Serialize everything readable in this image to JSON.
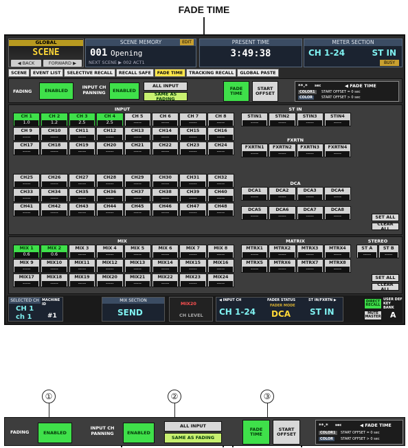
{
  "callout_title": "FADE TIME",
  "header": {
    "global": "GLOBAL",
    "scene": "SCENE",
    "back": "◀ BACK",
    "forward": "FORWARD ▶",
    "scene_memory_title": "SCENE MEMORY",
    "scene_number": "001",
    "scene_name": "Opening",
    "edit": "EDIT",
    "next": "NEXT SCENE",
    "next_scene": "▶ 002 ACT1",
    "present_time_title": "PRESENT TIME",
    "present_time": "3:49:38",
    "meter_title": "METER SECTION",
    "meter_ch": "CH 1-24",
    "meter_st": "ST IN",
    "busy": "BUSY"
  },
  "tabs": [
    "SCENE",
    "EVENT LIST",
    "SELECTIVE RECALL",
    "RECALL SAFE",
    "FADE TIME",
    "TRACKING RECALL",
    "GLOBAL PASTE"
  ],
  "active_tab": "FADE TIME",
  "controls": {
    "fading_label": "FADING",
    "fading_value": "ENABLED",
    "panning_label": "INPUT CH PANNING",
    "panning_value": "ENABLED",
    "all_input": "ALL INPUT",
    "same_as_fading": "SAME AS FADING",
    "fade_time": "FADE TIME",
    "start_offset": "START OFFSET",
    "legend_value": "**.*",
    "legend_sec": "sec",
    "legend_title": "◀ FADE TIME",
    "legend_color1": "COLOR1",
    "legend_color2": "COLOR",
    "legend_line1": "START OFFSET = 0 sec",
    "legend_line2": "START OFFSET > 0 sec"
  },
  "input": {
    "title": "INPUT",
    "channels": [
      {
        "name": "CH 1",
        "value": "1.0",
        "on": true
      },
      {
        "name": "CH 2",
        "value": "1.2",
        "on": true
      },
      {
        "name": "CH 3",
        "value": "2.5",
        "on": true
      },
      {
        "name": "CH 4",
        "value": "2.5",
        "on": true
      },
      {
        "name": "CH 5",
        "value": "-----",
        "on": false
      },
      {
        "name": "CH 6",
        "value": "-----",
        "on": false
      },
      {
        "name": "CH 7",
        "value": "-----",
        "on": false
      },
      {
        "name": "CH 8",
        "value": "-----",
        "on": false
      },
      {
        "name": "CH 9",
        "value": "-----",
        "on": false
      },
      {
        "name": "CH10",
        "value": "-----",
        "on": false
      },
      {
        "name": "CH11",
        "value": "-----",
        "on": false
      },
      {
        "name": "CH12",
        "value": "-----",
        "on": false
      },
      {
        "name": "CH13",
        "value": "-----",
        "on": false
      },
      {
        "name": "CH14",
        "value": "-----",
        "on": false
      },
      {
        "name": "CH15",
        "value": "-----",
        "on": false
      },
      {
        "name": "CH16",
        "value": "-----",
        "on": false
      },
      {
        "name": "CH17",
        "value": "-----",
        "on": false
      },
      {
        "name": "CH18",
        "value": "-----",
        "on": false
      },
      {
        "name": "CH19",
        "value": "-----",
        "on": false
      },
      {
        "name": "CH20",
        "value": "-----",
        "on": false
      },
      {
        "name": "CH21",
        "value": "-----",
        "on": false
      },
      {
        "name": "CH22",
        "value": "-----",
        "on": false
      },
      {
        "name": "CH23",
        "value": "-----",
        "on": false
      },
      {
        "name": "CH24",
        "value": "-----",
        "on": false
      }
    ],
    "channels2": [
      {
        "name": "CH25",
        "value": "-----",
        "on": false
      },
      {
        "name": "CH26",
        "value": "-----",
        "on": false
      },
      {
        "name": "CH27",
        "value": "-----",
        "on": false
      },
      {
        "name": "CH28",
        "value": "-----",
        "on": false
      },
      {
        "name": "CH29",
        "value": "-----",
        "on": false
      },
      {
        "name": "CH30",
        "value": "-----",
        "on": false
      },
      {
        "name": "CH31",
        "value": "-----",
        "on": false
      },
      {
        "name": "CH32",
        "value": "-----",
        "on": false
      },
      {
        "name": "CH33",
        "value": "-----",
        "on": false
      },
      {
        "name": "CH34",
        "value": "-----",
        "on": false
      },
      {
        "name": "CH35",
        "value": "-----",
        "on": false
      },
      {
        "name": "CH36",
        "value": "-----",
        "on": false
      },
      {
        "name": "CH37",
        "value": "-----",
        "on": false
      },
      {
        "name": "CH38",
        "value": "-----",
        "on": false
      },
      {
        "name": "CH39",
        "value": "-----",
        "on": false
      },
      {
        "name": "CH40",
        "value": "-----",
        "on": false
      },
      {
        "name": "CH41",
        "value": "-----",
        "on": false
      },
      {
        "name": "CH42",
        "value": "-----",
        "on": false
      },
      {
        "name": "CH43",
        "value": "-----",
        "on": false
      },
      {
        "name": "CH44",
        "value": "-----",
        "on": false
      },
      {
        "name": "CH45",
        "value": "-----",
        "on": false
      },
      {
        "name": "CH46",
        "value": "-----",
        "on": false
      },
      {
        "name": "CH47",
        "value": "-----",
        "on": false
      },
      {
        "name": "CH48",
        "value": "-----",
        "on": false
      }
    ]
  },
  "st_in": {
    "title": "ST IN",
    "channels": [
      {
        "name": "STIN1",
        "value": "-----",
        "on": false
      },
      {
        "name": "STIN2",
        "value": "-----",
        "on": false
      },
      {
        "name": "STIN3",
        "value": "-----",
        "on": false
      },
      {
        "name": "STIN4",
        "value": "-----",
        "on": false
      }
    ]
  },
  "fxrtn": {
    "title": "FXRTN",
    "channels": [
      {
        "name": "FXRTN1",
        "value": "-----",
        "on": false
      },
      {
        "name": "FXRTN2",
        "value": "-----",
        "on": false
      },
      {
        "name": "FXRTN3",
        "value": "-----",
        "on": false
      },
      {
        "name": "FXRTN4",
        "value": "-----",
        "on": false
      }
    ]
  },
  "dca": {
    "title": "DCA",
    "channels": [
      {
        "name": "DCA1",
        "value": "-----",
        "on": false
      },
      {
        "name": "DCA2",
        "value": "-----",
        "on": false
      },
      {
        "name": "DCA3",
        "value": "-----",
        "on": false
      },
      {
        "name": "DCA4",
        "value": "-----",
        "on": false
      },
      {
        "name": "DCA5",
        "value": "-----",
        "on": false
      },
      {
        "name": "DCA6",
        "value": "-----",
        "on": false
      },
      {
        "name": "DCA7",
        "value": "-----",
        "on": false
      },
      {
        "name": "DCA8",
        "value": "-----",
        "on": false
      }
    ],
    "set_all": "SET ALL",
    "clear_all": "CLEAR ALL"
  },
  "mix": {
    "title": "MIX",
    "channels": [
      {
        "name": "MIX 1",
        "value": "0.6",
        "on": true
      },
      {
        "name": "MIX 2",
        "value": "0.6",
        "on": true
      },
      {
        "name": "MIX 3",
        "value": "-----",
        "on": false
      },
      {
        "name": "MIX 4",
        "value": "-----",
        "on": false
      },
      {
        "name": "MIX 5",
        "value": "-----",
        "on": false
      },
      {
        "name": "MIX 6",
        "value": "-----",
        "on": false
      },
      {
        "name": "MIX 7",
        "value": "-----",
        "on": false
      },
      {
        "name": "MIX 8",
        "value": "-----",
        "on": false
      },
      {
        "name": "MIX 9",
        "value": "-----",
        "on": false
      },
      {
        "name": "MIX10",
        "value": "-----",
        "on": false
      },
      {
        "name": "MIX11",
        "value": "-----",
        "on": false
      },
      {
        "name": "MIX12",
        "value": "-----",
        "on": false
      },
      {
        "name": "MIX13",
        "value": "-----",
        "on": false
      },
      {
        "name": "MIX14",
        "value": "-----",
        "on": false
      },
      {
        "name": "MIX15",
        "value": "-----",
        "on": false
      },
      {
        "name": "MIX16",
        "value": "-----",
        "on": false
      },
      {
        "name": "MIX17",
        "value": "-----",
        "on": false
      },
      {
        "name": "MIX18",
        "value": "-----",
        "on": false
      },
      {
        "name": "MIX19",
        "value": "-----",
        "on": false
      },
      {
        "name": "MIX20",
        "value": "-----",
        "on": false
      },
      {
        "name": "MIX21",
        "value": "-----",
        "on": false
      },
      {
        "name": "MIX22",
        "value": "-----",
        "on": false
      },
      {
        "name": "MIX23",
        "value": "-----",
        "on": false
      },
      {
        "name": "MIX24",
        "value": "-----",
        "on": false
      }
    ]
  },
  "matrix": {
    "title": "MATRIX",
    "channels": [
      {
        "name": "MTRX1",
        "value": "-----",
        "on": false
      },
      {
        "name": "MTRX2",
        "value": "-----",
        "on": false
      },
      {
        "name": "MTRX3",
        "value": "-----",
        "on": false
      },
      {
        "name": "MTRX4",
        "value": "-----",
        "on": false
      },
      {
        "name": "MTRX5",
        "value": "-----",
        "on": false
      },
      {
        "name": "MTRX6",
        "value": "-----",
        "on": false
      },
      {
        "name": "MTRX7",
        "value": "-----",
        "on": false
      },
      {
        "name": "MTRX8",
        "value": "-----",
        "on": false
      }
    ]
  },
  "stereo": {
    "title": "STEREO",
    "channels": [
      {
        "name": "ST A",
        "value": "-----",
        "on": false
      },
      {
        "name": "ST B",
        "value": "-----",
        "on": false
      }
    ],
    "set_all": "SET ALL",
    "clear_all": "CLEAR ALL"
  },
  "bottom": {
    "selected_ch_title": "SELECTED CH",
    "selected_ch": "CH 1",
    "selected_ch_name": "ch 1",
    "machine_id_title": "MACHINE ID",
    "machine_id": "#1",
    "mix_section_title": "MIX SECTION",
    "send": "SEND",
    "mix_label": "MIX20",
    "ch_level": "CH LEVEL",
    "input_ch_title": "◀ INPUT CH",
    "fader_status_title": "FADER STATUS",
    "fader_mode": "FADER MODE",
    "st_in_fxrtn_title": "ST IN/FXRTN ▶",
    "input_ch": "CH 1-24",
    "dca": "DCA",
    "st_in": "ST IN",
    "direct_recall": "DIRECT RECALL",
    "mute_master": "MUTE MASTER",
    "user_key_bank_title": "USER DEF KEY BANK",
    "user_key_bank": "A"
  },
  "callouts": [
    "①",
    "②",
    "③"
  ],
  "strip": {
    "fading_label": "FADING",
    "fading_value": "ENABLED",
    "panning_label": "INPUT CH PANNING",
    "panning_value": "ENABLED",
    "all_input": "ALL INPUT",
    "same_as_fading": "SAME AS FADING",
    "fade_time": "FADE TIME",
    "start_offset": "START OFFSET",
    "legend_value": "**.*",
    "legend_sec": "sec",
    "legend_title": "◀ FADE TIME",
    "legend_color1": "COLOR1",
    "legend_color2": "COLOR",
    "legend_line1": "START OFFSET = 0 sec",
    "legend_line2": "START OFFSET > 0 sec"
  }
}
